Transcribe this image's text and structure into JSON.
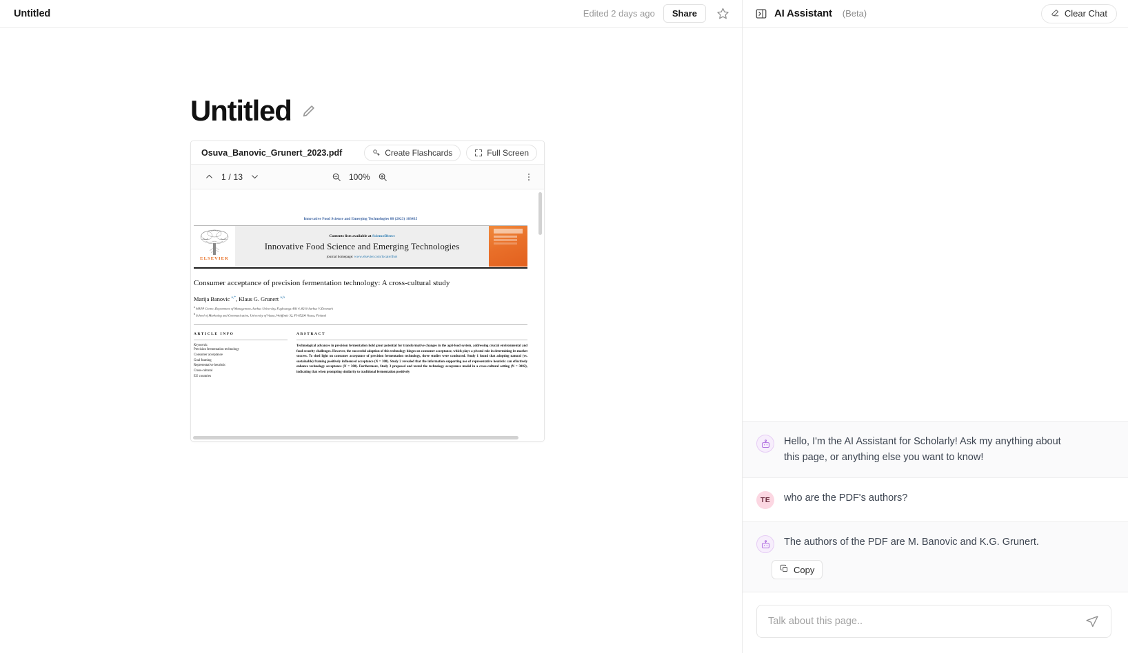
{
  "doc": {
    "topbar": {
      "title": "Untitled",
      "edited_label": "Edited 2 days ago",
      "share_label": "Share",
      "star_icon": "star-outline-icon"
    },
    "page_title": "Untitled",
    "edit_icon": "pencil-icon"
  },
  "pdf": {
    "filename": "Osuva_Banovic_Grunert_2023.pdf",
    "create_flashcards_label": "Create Flashcards",
    "full_screen_label": "Full Screen",
    "flashcards_icon": "flashcards-icon",
    "fullscreen_icon": "expand-icon",
    "toolbar": {
      "prev_icon": "chevron-up-icon",
      "next_icon": "chevron-down-icon",
      "page_indicator": "1 / 13",
      "zoom_out_icon": "zoom-out-icon",
      "zoom_level": "100%",
      "zoom_in_icon": "zoom-in-icon",
      "more_icon": "more-vertical-icon"
    }
  },
  "paper": {
    "running_head": "Innovative Food Science and Emerging Technologies 88 (2023) 103435",
    "contents_prefix": "Contents lists available at ",
    "contents_link": "ScienceDirect",
    "journal_name": "Innovative Food Science and Emerging Technologies",
    "homepage_prefix": "journal homepage: ",
    "homepage_link": "www.elsevier.com/locate/ifset",
    "publisher": "ELSEVIER",
    "title": "Consumer acceptance of precision fermentation technology: A cross-cultural study",
    "authors_html": "Marija Banovic <sup>a,*</sup>, Klaus G. Grunert <sup>a,b</sup>",
    "affiliations": [
      "MAPP Centre, Department of Management, Aarhus University, Fuglesangs Allé 4, 8210 Aarhus V, Denmark",
      "School of Marketing and Communication, University of Vaasa, Wolffintie 32, FI-65200 Vaasa, Finland"
    ],
    "article_info_heading": "ARTICLE INFO",
    "keywords_label": "Keywords:",
    "keywords": [
      "Precision fermentation technology",
      "Consumer acceptance",
      "Goal framing",
      "Representative heuristic",
      "Cross-cultural",
      "EU countries"
    ],
    "abstract_heading": "ABSTRACT",
    "abstract": "Technological advances in precision fermentation hold great potential for transformative changes in the agri-food system, addressing crucial environmental and food security challenges. However, the successful adoption of this technology hinges on consumer acceptance, which plays a pivotal role in determining its market success. To shed light on consumer acceptance of precision fermentation technology, three studies were conducted. Study 1 found that adopting natural (vs. sustainable) framing positively influenced acceptance (N = 308). Study 2 revealed that the information supporting use of representative heuristic can effectively enhance technology acceptance (N = 300). Furthermore, Study 3 proposed and tested the technology acceptance model in a cross-cultural setting (N = 3082), indicating that when prompting similarity to traditional fermentation positively"
  },
  "ai": {
    "panel_toggle_icon": "panel-collapse-icon",
    "title": "AI Assistant",
    "beta_label": "(Beta)",
    "clear_chat_label": "Clear Chat",
    "clear_chat_icon": "eraser-icon",
    "messages": [
      {
        "role": "bot",
        "avatar_icon": "robot-icon",
        "text": "Hello, I'm the AI Assistant for Scholarly! Ask my anything about this page, or anything else you want to know!"
      },
      {
        "role": "user",
        "avatar_initials": "TE",
        "text": "who are the PDF's authors?"
      },
      {
        "role": "bot",
        "avatar_icon": "robot-icon",
        "text": "The authors of the PDF are M. Banovic and K.G. Grunert.",
        "copy_label": "Copy",
        "copy_icon": "copy-icon"
      }
    ],
    "composer": {
      "placeholder": "Talk about this page..",
      "value": "",
      "send_icon": "send-icon"
    }
  },
  "colors": {
    "accent_purple": "#b06fe0",
    "user_avatar_pink": "#fcd7e2",
    "elsevier_orange": "#e86c1f",
    "link_blue": "#2a7ab0"
  }
}
